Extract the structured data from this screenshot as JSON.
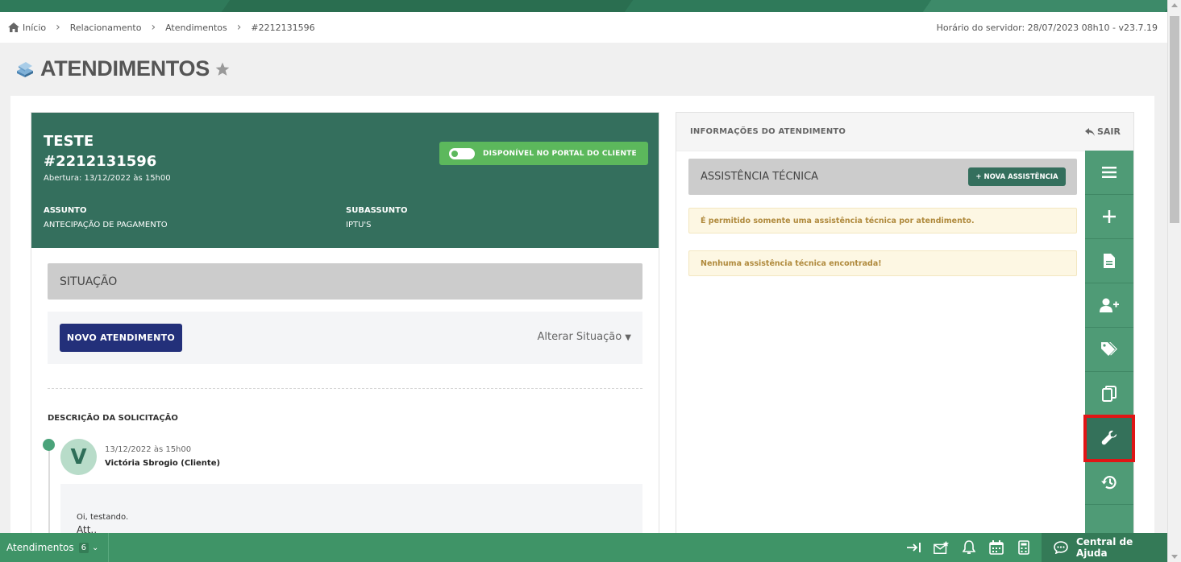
{
  "breadcrumb": [
    "Início",
    "Relacionamento",
    "Atendimentos",
    "#2212131596"
  ],
  "server_time": "Horário do servidor: 28/07/2023 08h10 - v23.7.19",
  "page": {
    "title": "ATENDIMENTOS"
  },
  "ticket": {
    "name": "TESTE",
    "number": "#2212131596",
    "opened": "Abertura: 13/12/2022 às 15h00",
    "portal_label": "DISPONÍVEL NO PORTAL DO CLIENTE",
    "subject_label": "ASSUNTO",
    "subject": "ANTECIPAÇÃO DE PAGAMENTO",
    "subsubject_label": "SUBASSUNTO",
    "subsubject": "IPTU'S"
  },
  "situation": {
    "title": "SITUAÇÃO",
    "new_button": "NOVO ATENDIMENTO",
    "change_label": "Alterar Situação"
  },
  "description": {
    "label": "DESCRIÇÃO DA SOLICITAÇÃO",
    "avatar_letter": "V",
    "date": "13/12/2022 às 15h00",
    "author": "Victória Sbrogio (Cliente)",
    "line1": "Oi, testando.",
    "line2": "Att.,"
  },
  "info_panel": {
    "title": "INFORMAÇÕES DO ATENDIMENTO",
    "exit": "SAIR",
    "section_title": "ASSISTÊNCIA TÉCNICA",
    "new_button": "+ NOVA ASSISTÊNCIA",
    "alert1": "É permitido somente uma assistência técnica por atendimento.",
    "alert2": "Nenhuma assistência técnica encontrada!"
  },
  "toolbar": {
    "items": [
      "menu-icon",
      "plus-icon",
      "document-icon",
      "add-user-icon",
      "tags-icon",
      "copy-icon",
      "wrench-icon",
      "history-icon"
    ],
    "active": "wrench-icon"
  },
  "bottom": {
    "label": "Atendimentos",
    "count": "6",
    "help": "Central de Ajuda"
  },
  "colors": {
    "header_green": "#346f5d",
    "toolbar_green": "#4f9b76",
    "portal_green": "#5cb85c",
    "navy_button": "#23307a",
    "highlight_red": "#e01515"
  }
}
